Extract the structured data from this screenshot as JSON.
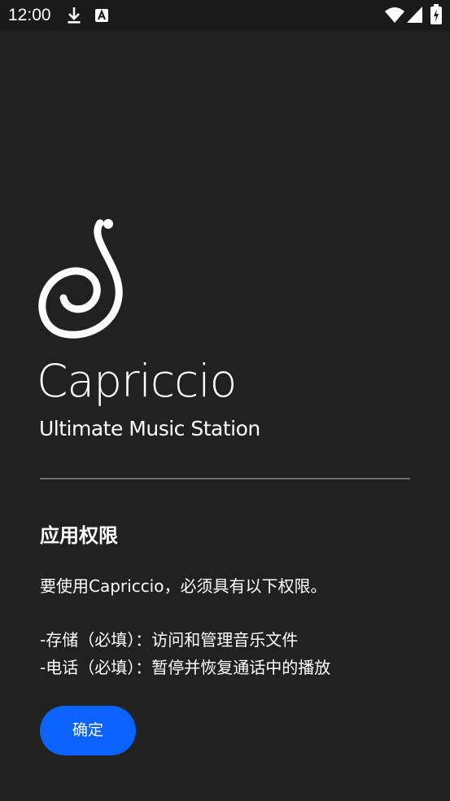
{
  "status_bar": {
    "time": "12:00",
    "icons": [
      "download-icon",
      "text-notification-icon",
      "wifi-icon",
      "cellular-signal-icon",
      "battery-icon"
    ]
  },
  "branding": {
    "logo_icon": "capriccio-logo-icon",
    "app_name": "Capriccio",
    "tagline": "Ultimate Music Station"
  },
  "permissions": {
    "title": "应用权限",
    "description": "要使用Capriccio，必须具有以下权限。",
    "items": [
      "-存储（必填）：访问和管理音乐文件",
      "-电话（必填）：暂停并恢复通话中的播放"
    ]
  },
  "actions": {
    "confirm_label": "确定"
  },
  "colors": {
    "background": "#212121",
    "status_bar": "#1a1a1a",
    "accent": "#0a63ff",
    "divider": "#6e6e6e",
    "text": "#ffffff"
  }
}
